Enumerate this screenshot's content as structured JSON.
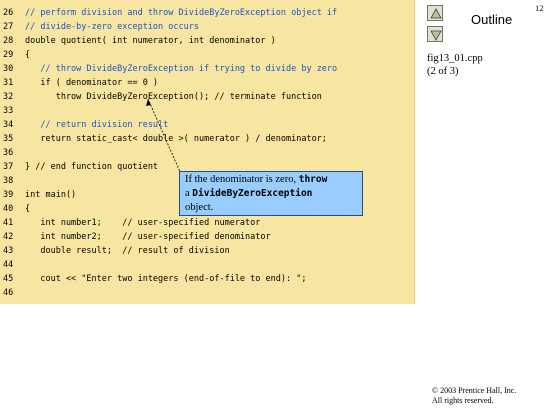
{
  "slide_number": "12",
  "outline": {
    "title": "Outline",
    "file_name": "fig13_01.cpp",
    "page_info": "(2 of 3)"
  },
  "code_lines": [
    {
      "num": "26",
      "text": "// perform division and throw DivideByZeroException object if",
      "class": "cm"
    },
    {
      "num": "27",
      "text": "// divide-by-zero exception occurs",
      "class": "cm"
    },
    {
      "num": "28",
      "text": "double quotient( int numerator, int denominator )",
      "class": ""
    },
    {
      "num": "29",
      "text": "{",
      "class": ""
    },
    {
      "num": "30",
      "text": "   // throw DivideByZeroException if trying to divide by zero",
      "class": "cm"
    },
    {
      "num": "31",
      "text": "   if ( denominator == 0 )",
      "class": ""
    },
    {
      "num": "32",
      "text": "      throw DivideByZeroException(); // terminate function",
      "class": ""
    },
    {
      "num": "33",
      "text": "",
      "class": ""
    },
    {
      "num": "34",
      "text": "   // return division result",
      "class": "cm"
    },
    {
      "num": "35",
      "text": "   return static_cast< double >( numerator ) / denominator;",
      "class": ""
    },
    {
      "num": "36",
      "text": "",
      "class": ""
    },
    {
      "num": "37",
      "text": "} // end function quotient",
      "class": ""
    },
    {
      "num": "38",
      "text": "",
      "class": ""
    },
    {
      "num": "39",
      "text": "int main()",
      "class": ""
    },
    {
      "num": "40",
      "text": "{",
      "class": ""
    },
    {
      "num": "41",
      "text": "   int number1;    // user-specified numerator",
      "class": ""
    },
    {
      "num": "42",
      "text": "   int number2;    // user-specified denominator",
      "class": ""
    },
    {
      "num": "43",
      "text": "   double result;  // result of division",
      "class": ""
    },
    {
      "num": "44",
      "text": "",
      "class": ""
    },
    {
      "num": "45",
      "text": "   cout << \"Enter two integers (end-of-file to end): \";",
      "class": ""
    },
    {
      "num": "46",
      "text": "",
      "class": ""
    }
  ],
  "callout": {
    "line1_pre": "If the denominator is zero, ",
    "line1_code": "throw",
    "line2_pre": "a ",
    "line2_code": "DivideByZeroException",
    "line3": "object."
  },
  "copyright": {
    "line1": "© 2003 Prentice Hall, Inc.",
    "line2": "All rights reserved."
  },
  "colors": {
    "code_background": "#f7e6a1",
    "callout_background": "#99ccff",
    "comment": "#1d52c9"
  }
}
